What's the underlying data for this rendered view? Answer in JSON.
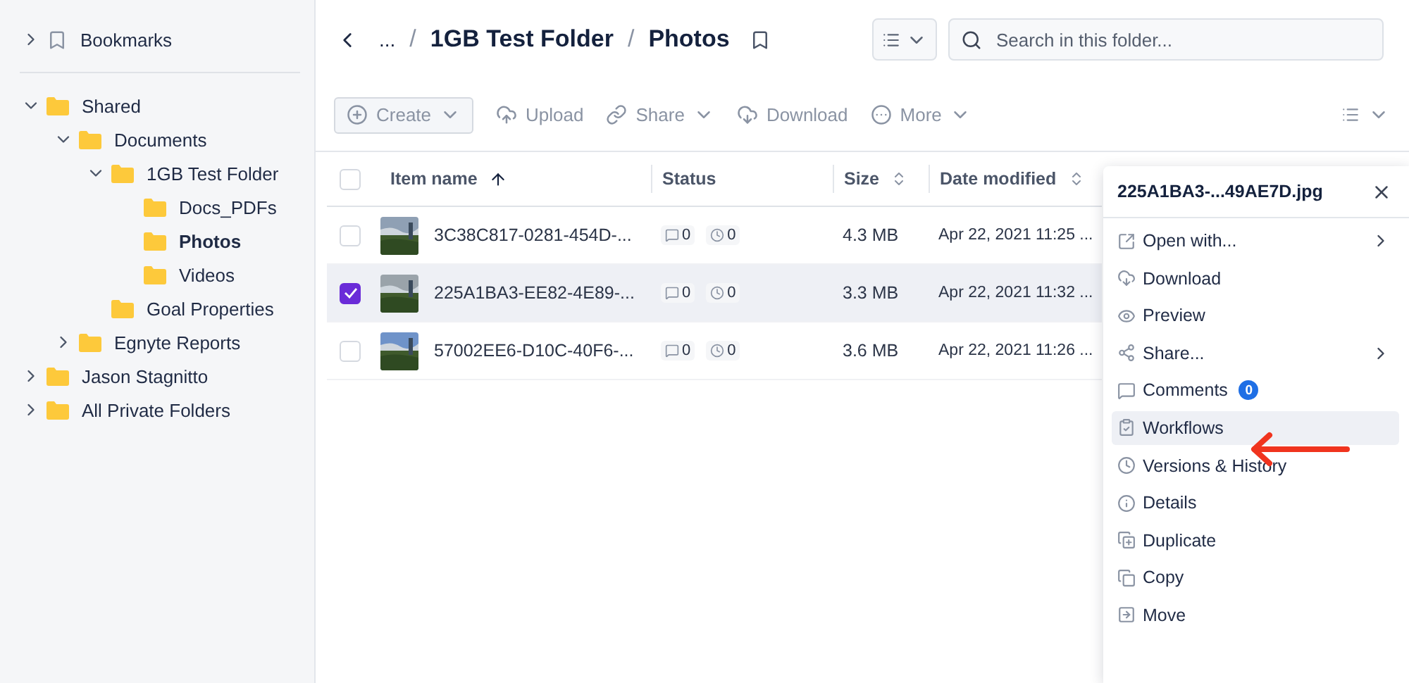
{
  "sidebar": {
    "bookmarks": {
      "label": "Bookmarks",
      "expanded": false
    },
    "tree": [
      {
        "label": "Shared",
        "has_children": true,
        "expanded": true,
        "selected": false,
        "children": [
          {
            "label": "Documents",
            "has_children": true,
            "expanded": true,
            "selected": false,
            "children": [
              {
                "label": "1GB Test Folder",
                "has_children": true,
                "expanded": true,
                "selected": false,
                "children": [
                  {
                    "label": "Docs_PDFs",
                    "has_children": false,
                    "expanded": false,
                    "selected": false
                  },
                  {
                    "label": "Photos",
                    "has_children": false,
                    "expanded": false,
                    "selected": true
                  },
                  {
                    "label": "Videos",
                    "has_children": false,
                    "expanded": false,
                    "selected": false
                  }
                ]
              },
              {
                "label": "Goal Properties",
                "has_children": false,
                "expanded": false,
                "selected": false
              }
            ]
          },
          {
            "label": "Egnyte Reports",
            "has_children": true,
            "expanded": false,
            "selected": false
          }
        ]
      },
      {
        "label": "Jason Stagnitto",
        "has_children": true,
        "expanded": false,
        "selected": false
      },
      {
        "label": "All Private Folders",
        "has_children": true,
        "expanded": false,
        "selected": false
      }
    ]
  },
  "breadcrumb": {
    "ellipsis": "...",
    "separator": "/",
    "items": [
      "1GB Test Folder",
      "Photos"
    ]
  },
  "search": {
    "placeholder": "Search in this folder..."
  },
  "toolbar": [
    {
      "kind": "create",
      "label": "Create",
      "dropdown": true
    },
    {
      "kind": "upload",
      "label": "Upload",
      "dropdown": false
    },
    {
      "kind": "share",
      "label": "Share",
      "dropdown": true
    },
    {
      "kind": "download",
      "label": "Download",
      "dropdown": false
    },
    {
      "kind": "more",
      "label": "More",
      "dropdown": true
    }
  ],
  "table": {
    "select_all": {
      "checked": false
    },
    "columns": [
      {
        "label": "Item name",
        "kind": "sorted"
      },
      {
        "label": "Status",
        "kind": "plain"
      },
      {
        "label": "Size",
        "kind": "sortable"
      },
      {
        "label": "Date modified",
        "kind": "sortable"
      }
    ],
    "rows": [
      {
        "name": "3C38C817-0281-454D-...",
        "comments": "0",
        "versions": "0",
        "size": "4.3 MB",
        "date": "Apr 22, 2021 11:25 ...",
        "selected": false
      },
      {
        "name": "225A1BA3-EE82-4E89-...",
        "comments": "0",
        "versions": "0",
        "size": "3.3 MB",
        "date": "Apr 22, 2021 11:32 ...",
        "selected": true
      },
      {
        "name": "57002EE6-D10C-40F6-...",
        "comments": "0",
        "versions": "0",
        "size": "3.6 MB",
        "date": "Apr 22, 2021 11:26 ...",
        "selected": false
      }
    ]
  },
  "menu": {
    "title": "225A1BA3-...49AE7D.jpg",
    "items": [
      {
        "kind": "open",
        "label": "Open with...",
        "submenu": true,
        "selected": false
      },
      {
        "kind": "download",
        "label": "Download",
        "submenu": false,
        "selected": false
      },
      {
        "kind": "preview",
        "label": "Preview",
        "submenu": false,
        "selected": false
      },
      {
        "kind": "share",
        "label": "Share...",
        "submenu": true,
        "selected": false
      },
      {
        "kind": "comments",
        "label": "Comments",
        "badge": "0",
        "submenu": false,
        "selected": false
      },
      {
        "kind": "workflows",
        "label": "Workflows",
        "submenu": false,
        "selected": true
      },
      {
        "kind": "versions",
        "label": "Versions & History",
        "submenu": false,
        "selected": false
      },
      {
        "kind": "details",
        "label": "Details",
        "submenu": false,
        "selected": false
      },
      {
        "kind": "duplicate",
        "label": "Duplicate",
        "submenu": false,
        "selected": false
      },
      {
        "kind": "copy",
        "label": "Copy",
        "submenu": false,
        "selected": false
      },
      {
        "kind": "move",
        "label": "Move",
        "submenu": false,
        "selected": false
      }
    ]
  }
}
